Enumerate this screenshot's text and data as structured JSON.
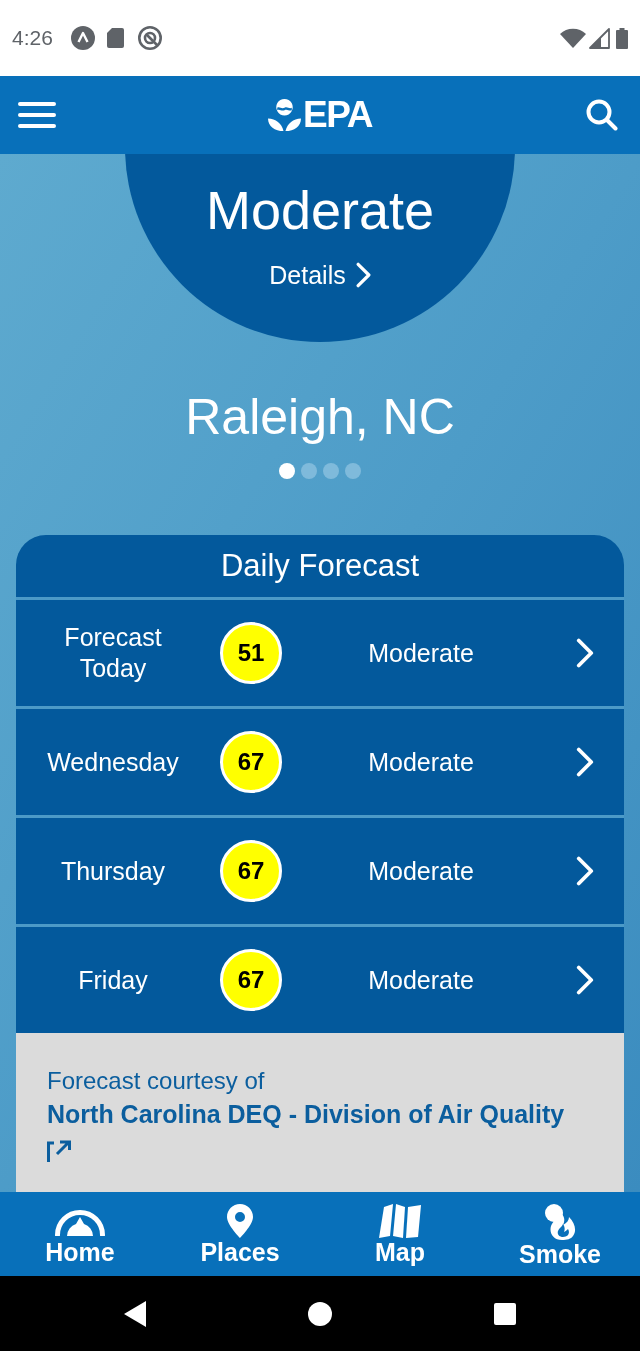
{
  "status_bar": {
    "time": "4:26"
  },
  "header": {
    "logo_text": "EPA"
  },
  "current": {
    "category": "Moderate",
    "details": "Details"
  },
  "location": {
    "name": "Raleigh, NC",
    "pages": [
      {
        "selected": true
      },
      {
        "selected": false
      },
      {
        "selected": false
      },
      {
        "selected": false
      }
    ]
  },
  "daily_forecast": {
    "title": "Daily Forecast",
    "rows": [
      {
        "day": "Forecast Today",
        "aqi": "51",
        "color": "#ffff00",
        "category": "Moderate"
      },
      {
        "day": "Wednesday",
        "aqi": "67",
        "color": "#ffff00",
        "category": "Moderate"
      },
      {
        "day": "Thursday",
        "aqi": "67",
        "color": "#ffff00",
        "category": "Moderate"
      },
      {
        "day": "Friday",
        "aqi": "67",
        "color": "#ffff00",
        "category": "Moderate"
      }
    ]
  },
  "courtesy": {
    "label": "Forecast courtesy of",
    "source": "North Carolina DEQ - Division of Air Quality"
  },
  "bottom_nav": [
    {
      "kind": "home",
      "label": "Home"
    },
    {
      "kind": "places",
      "label": "Places"
    },
    {
      "kind": "map",
      "label": "Map"
    },
    {
      "kind": "smoke",
      "label": "Smoke"
    }
  ]
}
